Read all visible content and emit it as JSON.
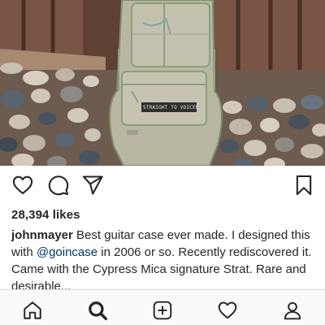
{
  "post": {
    "photo_label": "STRAIGHT TO VOICEMAIL",
    "icons": {
      "like": "heart-icon",
      "comment": "speech-bubble-icon",
      "share": "paper-plane-icon",
      "save": "bookmark-icon"
    },
    "likes": "28,394 likes",
    "caption": {
      "username": "johnmayer",
      "text_before": " Best guitar case ever made. I designed this with ",
      "mention": "@goincase",
      "text_after": " in 2006 or so. Recently rediscovered it. Came with the Cypress Mica signature Strat. Rare and desirable..."
    }
  },
  "nav": {
    "items": [
      "home-icon",
      "search-icon",
      "new-post-icon",
      "activity-heart-icon",
      "profile-icon"
    ],
    "active": "search"
  },
  "colors": {
    "text": "#262626",
    "mention": "#003569",
    "nav_bg": "#fafafa",
    "divider": "#dbdbdb"
  }
}
